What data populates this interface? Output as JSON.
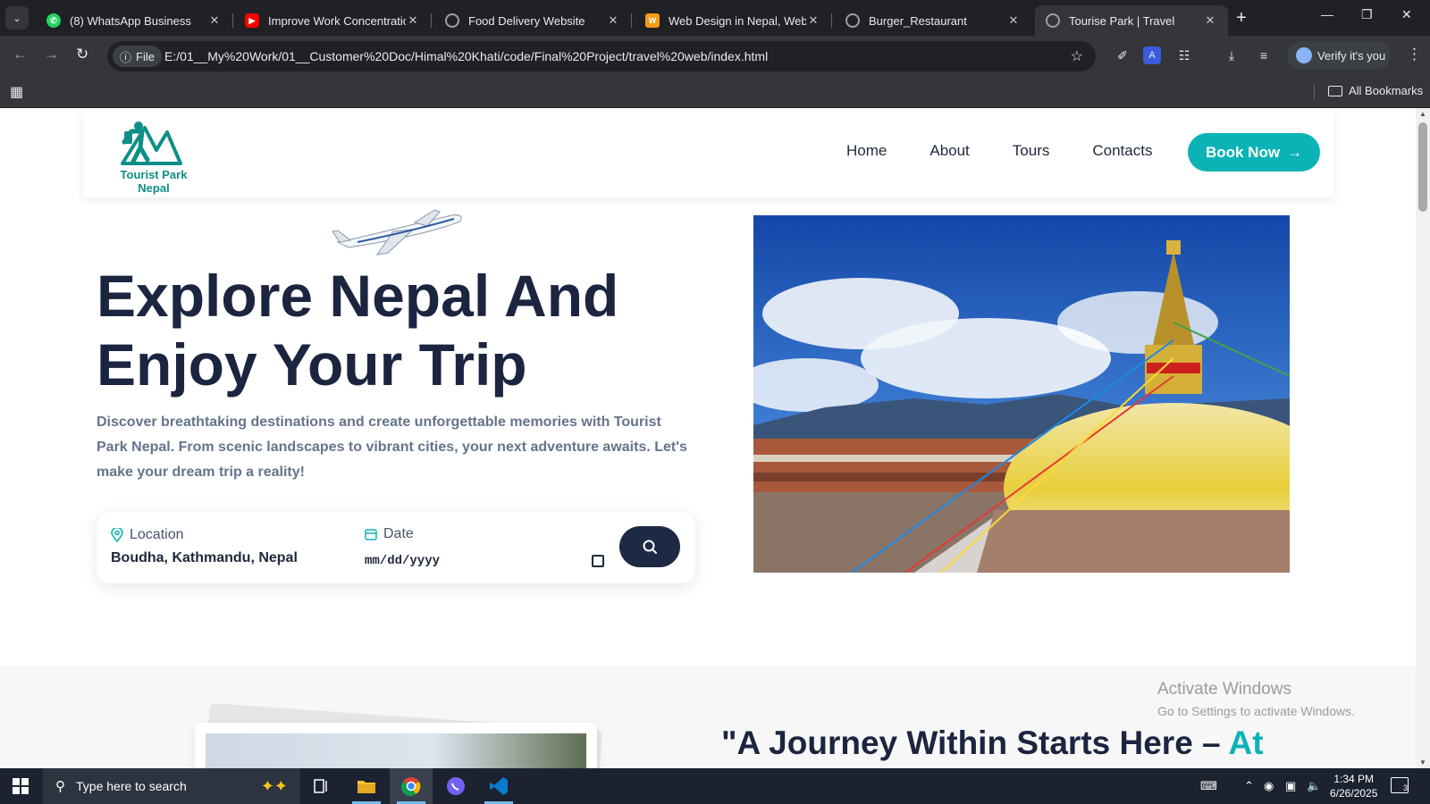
{
  "browser": {
    "tabs": [
      {
        "title": "(8) WhatsApp Business",
        "icon": "whatsapp-icon",
        "color": "#25d366"
      },
      {
        "title": "Improve Work Concentration",
        "icon": "youtube-icon",
        "color": "#ff0000"
      },
      {
        "title": "Food Delivery Website",
        "icon": "globe-icon",
        "color": "#9aa0a6"
      },
      {
        "title": "Web Design in Nepal, Website",
        "icon": "site-logo-icon",
        "color": "#f39c12"
      },
      {
        "title": "Burger_Restaurant",
        "icon": "globe-icon",
        "color": "#9aa0a6"
      },
      {
        "title": "Tourise Park | Travel",
        "icon": "globe-icon",
        "color": "#9aa0a6",
        "active": true
      }
    ],
    "chip_label": "File",
    "url": "E:/01__My%20Work/01__Customer%20Doc/Himal%20Khati/code/Final%20Project/travel%20web/index.html",
    "profile_label": "Verify it's you",
    "all_bookmarks": "All Bookmarks"
  },
  "site": {
    "logo_text": "Tourist Park Nepal",
    "nav": [
      "Home",
      "About",
      "Tours",
      "Contacts"
    ],
    "book_button": "Book Now",
    "hero": {
      "title_line1": "Explore Nepal And",
      "title_line2": "Enjoy Your Trip",
      "description": "Discover breathtaking destinations and create unforgettable memories with Tourist Park Nepal. From scenic landscapes to vibrant cities, your next adventure awaits. Let's make your dream trip a reality!"
    },
    "search": {
      "location_label": "Location",
      "location_value": "Boudha, Kathmandu, Nepal",
      "date_label": "Date",
      "date_placeholder": "mm/dd/yyyy"
    },
    "quote_main": "\"A Journey Within Starts Here – ",
    "quote_accent": "At",
    "accent_color": "#0bb3b6",
    "dark_color": "#1b2540"
  },
  "os": {
    "activate_title": "Activate Windows",
    "activate_sub": "Go to Settings to activate Windows.",
    "search_placeholder": "Type here to search",
    "time": "1:34 PM",
    "date": "6/26/2025",
    "notifications": "3"
  }
}
